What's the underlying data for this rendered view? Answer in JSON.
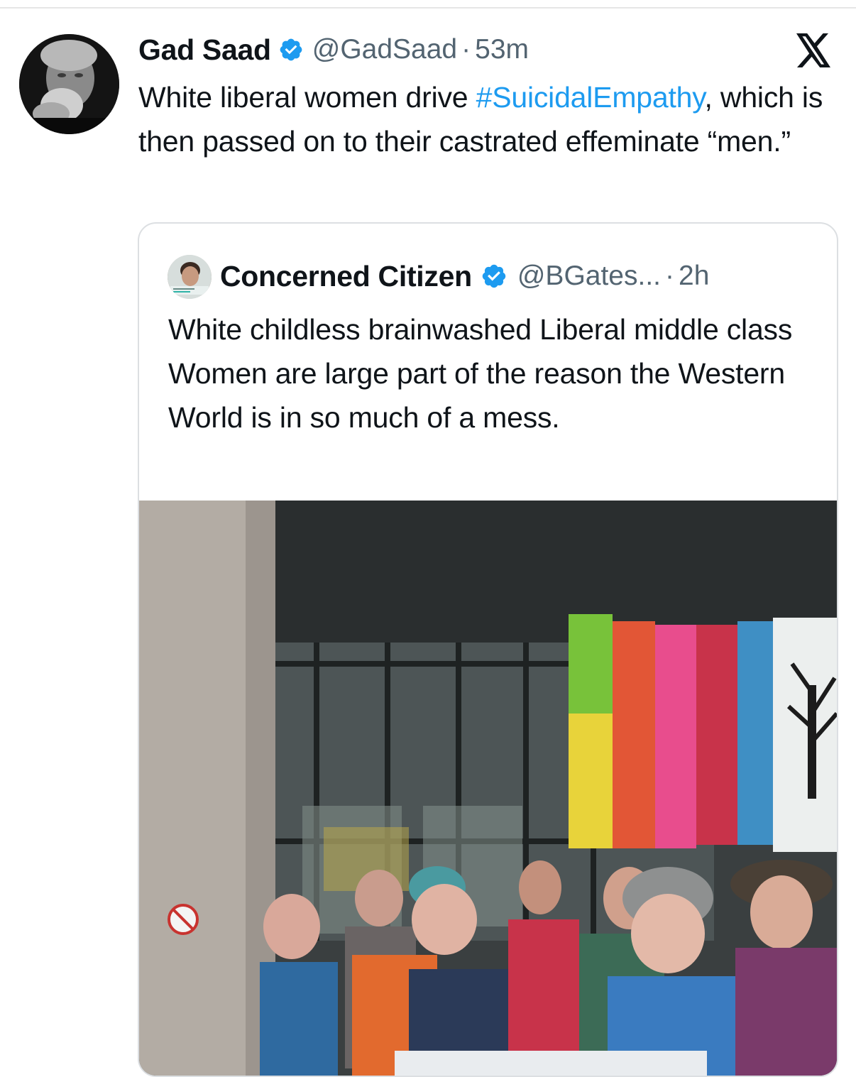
{
  "tweet": {
    "author_name": "Gad Saad",
    "handle": "@GadSaad",
    "separator": "·",
    "time": "53m",
    "text_before": "White liberal women drive ",
    "hashtag": "#SuicidalEmpathy",
    "text_after": ", which is then passed on to their castrated effeminate “men.”"
  },
  "quoted_tweet": {
    "author_name": "Concerned Citizen",
    "handle": "@BGates...",
    "separator": "·",
    "time": "2h",
    "text": "White childless brainwashed Liberal middle class Women are large part of the reason the Western World is in so much of a mess."
  },
  "icons": {
    "verified": "verified-badge-icon",
    "platform": "x-logo-icon"
  },
  "colors": {
    "link": "#1d9bf0",
    "secondary_text": "#536471",
    "verified": "#1d9bf0"
  }
}
